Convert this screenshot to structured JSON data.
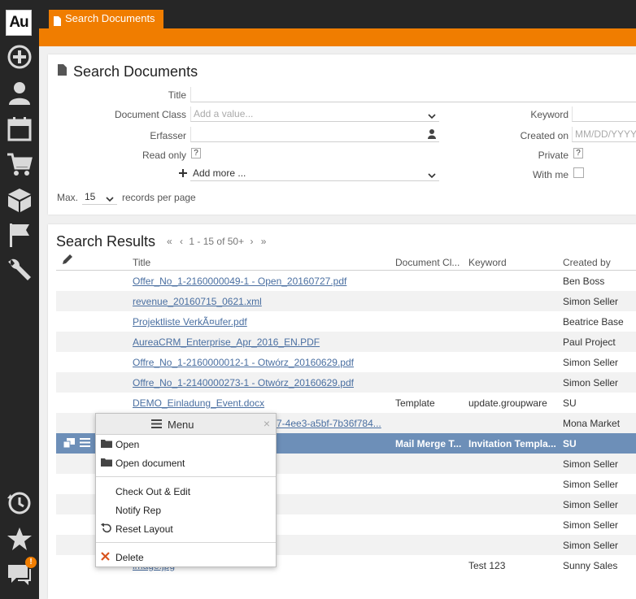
{
  "app": {
    "logo": "Au",
    "notification_count": "!"
  },
  "nav_icons": [
    "plus-circle-icon",
    "user-icon",
    "calendar-icon",
    "cart-icon",
    "box-icon",
    "flag-icon",
    "wrench-icon",
    "history-icon",
    "star-icon",
    "chat-icon"
  ],
  "tab": {
    "label": "Search Documents"
  },
  "search": {
    "title": "Search Documents",
    "title_label": "Title",
    "title_value": "",
    "doc_class_label": "Document Class",
    "doc_class_placeholder": "Add a value...",
    "erfasser_label": "Erfasser",
    "erfasser_value": "",
    "read_only_label": "Read only",
    "read_only_value": "?",
    "add_more_label": "Add more ...",
    "keyword_label": "Keyword",
    "created_on_label": "Created on",
    "created_on_placeholder": "MM/DD/YYYY",
    "private_label": "Private",
    "private_value": "?",
    "with_me_label": "With me",
    "max_label": "Max.",
    "max_value": "15",
    "records_label": "records per page"
  },
  "results": {
    "title": "Search Results",
    "pager_text": "1 - 15 of 50+",
    "columns": [
      "Title",
      "Document Cl...",
      "Keyword",
      "Created by"
    ],
    "rows": [
      {
        "title": "Offer_No_1-2160000049-1 - Open_20160727.pdf",
        "doc_class": "",
        "keyword": "",
        "created_by": "Ben Boss"
      },
      {
        "title": "revenue_20160715_0621.xml",
        "doc_class": "",
        "keyword": "",
        "created_by": "Simon Seller"
      },
      {
        "title": "Projektliste VerkÃ¤ufer.pdf",
        "doc_class": "",
        "keyword": "",
        "created_by": "Beatrice Base"
      },
      {
        "title": "AureaCRM_Enterprise_Apr_2016_EN.PDF",
        "doc_class": "",
        "keyword": "",
        "created_by": "Paul Project"
      },
      {
        "title": "Offre_No_1-2160000012-1 - Otwórz_20160629.pdf",
        "doc_class": "",
        "keyword": "",
        "created_by": "Simon Seller"
      },
      {
        "title": "Offre_No_1-2140000273-1 - Otwórz_20160629.pdf",
        "doc_class": "",
        "keyword": "",
        "created_by": "Simon Seller"
      },
      {
        "title": "DEMO_Einladung_Event.docx",
        "doc_class": "Template",
        "keyword": "update.groupware",
        "created_by": "SU"
      },
      {
        "title": "7-4ee3-a5bf-7b36f784...",
        "doc_class": "",
        "keyword": "",
        "created_by": "Mona Market"
      },
      {
        "title": "",
        "doc_class": "Mail Merge T...",
        "keyword": "Invitation Templa...",
        "created_by": "SU"
      },
      {
        "title": "",
        "doc_class": "",
        "keyword": "",
        "created_by": "Simon Seller"
      },
      {
        "title": "",
        "doc_class": "",
        "keyword": "",
        "created_by": "Simon Seller"
      },
      {
        "title": "",
        "doc_class": "",
        "keyword": "",
        "created_by": "Simon Seller"
      },
      {
        "title": "",
        "doc_class": "",
        "keyword": "",
        "created_by": "Simon Seller"
      },
      {
        "title": "",
        "doc_class": "",
        "keyword": "",
        "created_by": "Simon Seller"
      },
      {
        "title": "image.jpg",
        "doc_class": "",
        "keyword": "Test 123",
        "created_by": "Sunny Sales"
      }
    ]
  },
  "context_menu": {
    "title": "Menu",
    "close": "×",
    "items": [
      "Open",
      "Open document",
      "Check Out & Edit",
      "Notify Rep",
      "Reset Layout",
      "Delete"
    ]
  },
  "colors": {
    "accent": "#f07d00",
    "sidebar": "#262626",
    "selected_row": "#6d8fb8",
    "link": "#4a6fa1"
  }
}
